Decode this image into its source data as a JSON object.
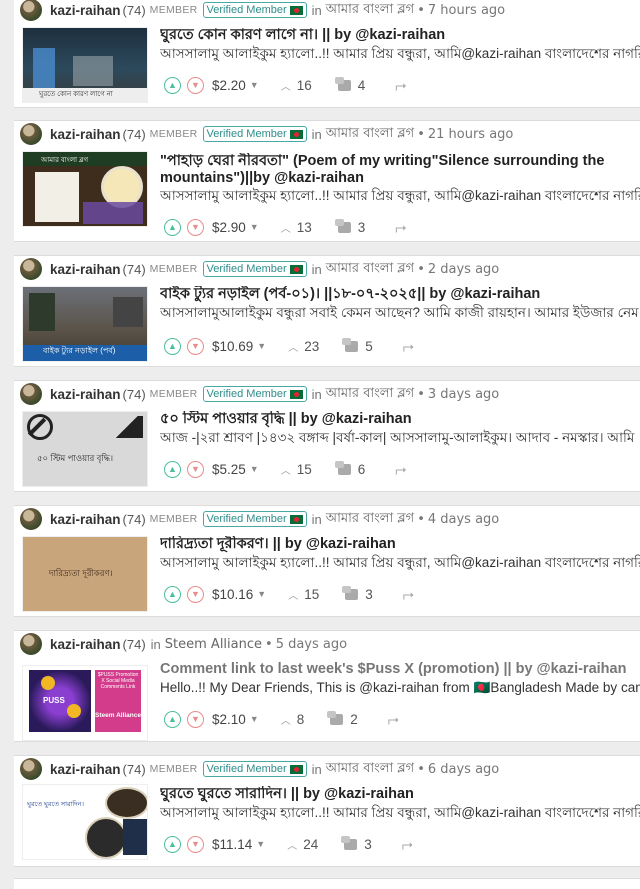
{
  "posts": [
    {
      "author": "kazi-raihan",
      "reputation": "(74)",
      "badge": "MEMBER",
      "verified": "Verified Member",
      "in_word": "in",
      "community": "আমার বাংলা ব্লগ",
      "time": "7 hours ago",
      "title": "ঘুরতে কোন কারণ লাগে না। || by @kazi-raihan",
      "excerpt": "আসসালামু আলাইকুম হ্যালো..!! আমার প্রিয় বন্ধুরা, আমি@kazi-raihan বাংলাদেশের নাগরিক",
      "thumb_caption": "ঘুরতে কোন কারণ লাগে না",
      "payout": "$2.20",
      "votes": "16",
      "comments": "4"
    },
    {
      "author": "kazi-raihan",
      "reputation": "(74)",
      "badge": "MEMBER",
      "verified": "Verified Member",
      "in_word": "in",
      "community": "আমার বাংলা ব্লগ",
      "time": "21 hours ago",
      "title": "\"পাহাড় ঘেরা নীরবতা\" (Poem of my writing\"Silence surrounding the mountains\")||by @kazi-raihan",
      "excerpt": "আসসালামু আলাইকুম হ্যালো..!! আমার প্রিয় বন্ধুরা, আমি@kazi-raihan বাংলাদেশের নাগরিক",
      "thumb_caption": "আমার বাংলা ব্লগ",
      "payout": "$2.90",
      "votes": "13",
      "comments": "3"
    },
    {
      "author": "kazi-raihan",
      "reputation": "(74)",
      "badge": "MEMBER",
      "verified": "Verified Member",
      "in_word": "in",
      "community": "আমার বাংলা ব্লগ",
      "time": "2 days ago",
      "title": "বাইক ট্যুর নড়াইল (পর্ব-০১)। ||১৮-০৭-২০২৫|| by @kazi-raihan",
      "excerpt": "আসসালামুআলাইকুম বন্ধুরা সবাই কেমন আছেন? আমি কাজী রায়হান। আমার ইউজার নেম",
      "thumb_caption": "বাইক ট্যুর নড়াইল (পর্ব)",
      "payout": "$10.69",
      "votes": "23",
      "comments": "5"
    },
    {
      "author": "kazi-raihan",
      "reputation": "(74)",
      "badge": "MEMBER",
      "verified": "Verified Member",
      "in_word": "in",
      "community": "আমার বাংলা ব্লগ",
      "time": "3 days ago",
      "title": "৫০ স্টিম পাওয়ার বৃদ্ধি || by @kazi-raihan",
      "excerpt": "আজ -|২রা শ্রাবণ |১৪৩২ বঙ্গাব্দ |বর্ষা-কাল| আসসালামু-আলাইকুম। আদাব - নমস্কার। আমি",
      "thumb_caption": "৫০ স্টিম পাওয়ার বৃদ্ধি।",
      "payout": "$5.25",
      "votes": "15",
      "comments": "6"
    },
    {
      "author": "kazi-raihan",
      "reputation": "(74)",
      "badge": "MEMBER",
      "verified": "Verified Member",
      "in_word": "in",
      "community": "আমার বাংলা ব্লগ",
      "time": "4 days ago",
      "title": "দারিদ্র্যতা দূরীকরণ। || by @kazi-raihan",
      "excerpt": "আসসালামু আলাইকুম হ্যালো..!! আমার প্রিয় বন্ধুরা, আমি@kazi-raihan বাংলাদেশের নাগরিক",
      "thumb_caption": "দারিদ্র্যতা দূরীকরণ।",
      "payout": "$10.16",
      "votes": "15",
      "comments": "3"
    },
    {
      "author": "kazi-raihan",
      "reputation": "(74)",
      "in_word": "in",
      "community": "Steem Alliance",
      "time": "5 days ago",
      "title": "Comment link to last week's $Puss X (promotion) || by @kazi-raihan",
      "excerpt": "Hello..!! My Dear Friends, This is @kazi-raihan from 🇧🇩Bangladesh Made by canva $PUSS",
      "thumb_caption": "Steem Alliance",
      "payout": "$2.10",
      "votes": "8",
      "comments": "2"
    },
    {
      "author": "kazi-raihan",
      "reputation": "(74)",
      "badge": "MEMBER",
      "verified": "Verified Member",
      "in_word": "in",
      "community": "আমার বাংলা ব্লগ",
      "time": "6 days ago",
      "title": "ঘুরতে ঘুরতে সারাদিন। || by @kazi-raihan",
      "excerpt": "আসসালামু আলাইকুম হ্যালো..!! আমার প্রিয় বন্ধুরা, আমি@kazi-raihan বাংলাদেশের নাগরিক",
      "thumb_caption": "ঘুরতে ঘুরতে সারাদিন।",
      "payout": "$11.14",
      "votes": "24",
      "comments": "3"
    }
  ],
  "thumb_texts": {
    "puss_promo": "$PUSS Promotion X Social Media Comments Link",
    "puss_word": "PUSS"
  },
  "icons": {
    "upvote": "upvote-icon",
    "downvote": "downvote-icon",
    "payout_caret": "caret-down-icon",
    "votes": "chevron-up-icon",
    "comments": "comments-icon",
    "resteem": "resteem-icon",
    "flag": "bangladesh-flag-icon"
  },
  "colors": {
    "accent": "#4bbf9c",
    "downvote": "#e88b8b",
    "verified": "#2d8e8a",
    "background": "#ededed"
  }
}
